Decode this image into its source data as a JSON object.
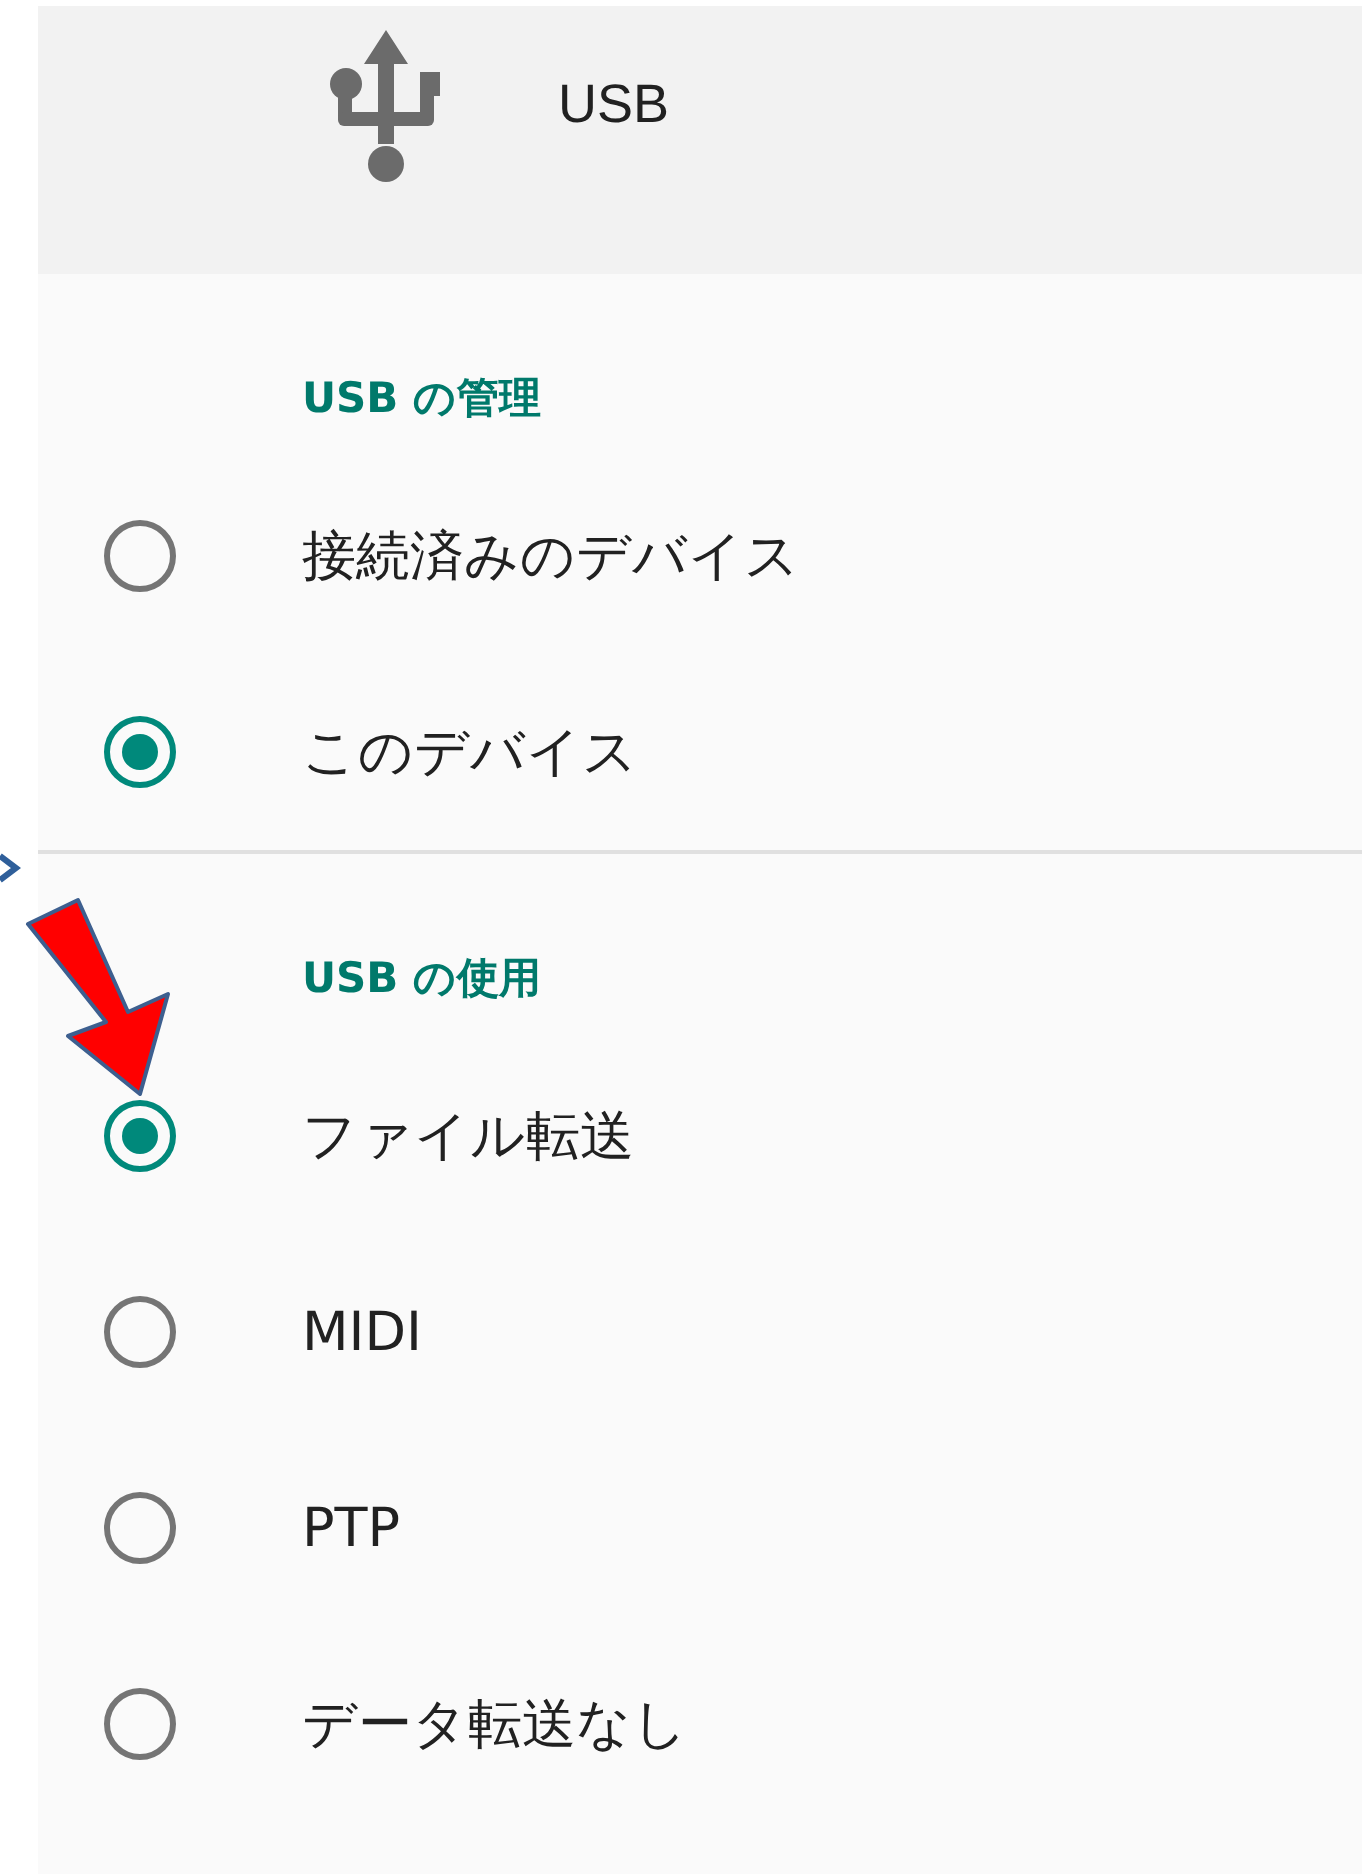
{
  "header": {
    "title": "USB"
  },
  "sections": [
    {
      "title": "USB の管理",
      "options": [
        {
          "label": "接続済みのデバイス",
          "selected": false
        },
        {
          "label": "このデバイス",
          "selected": true
        }
      ]
    },
    {
      "title": "USB の使用",
      "options": [
        {
          "label": "ファイル転送",
          "selected": true
        },
        {
          "label": "MIDI",
          "selected": false
        },
        {
          "label": "PTP",
          "selected": false
        },
        {
          "label": "データ転送なし",
          "selected": false
        }
      ]
    }
  ]
}
